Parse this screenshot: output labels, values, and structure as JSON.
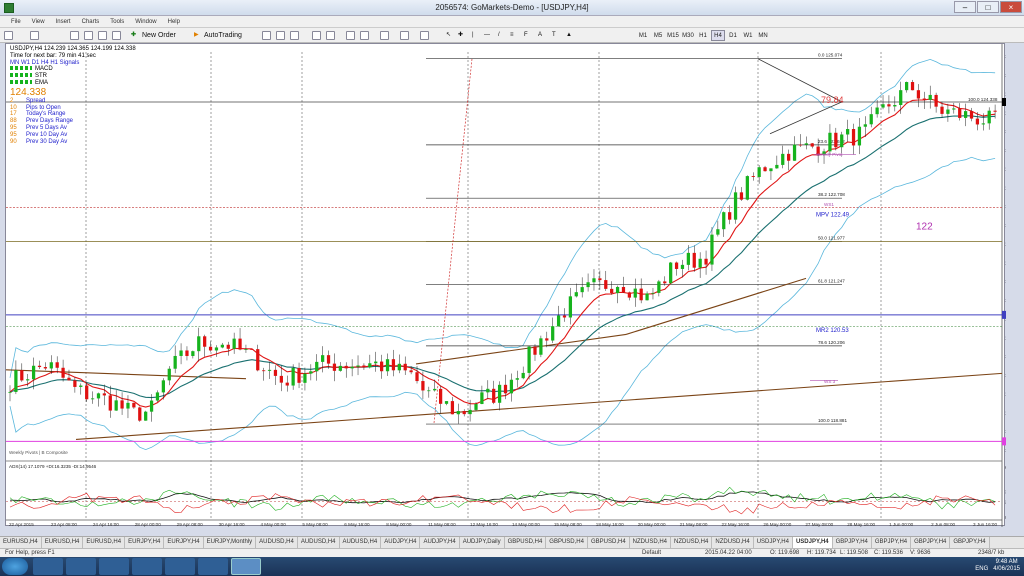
{
  "window": {
    "title": "2056574: GoMarkets-Demo - [USDJPY,H4]"
  },
  "menu": [
    "File",
    "View",
    "Insert",
    "Charts",
    "Tools",
    "Window",
    "Help"
  ],
  "toolbar": {
    "new_order": "New Order",
    "auto_trading": "AutoTrading",
    "timeframes": [
      "M1",
      "M5",
      "M15",
      "M30",
      "H1",
      "H4",
      "D1",
      "W1",
      "MN"
    ],
    "active_tf": "H4"
  },
  "info": {
    "line1": "USDJPY,H4  124.239 124.365 124.199 124.338",
    "line2": "Time for next bar: 79 min 41 sec",
    "line3": "MN W1 D1 H4 H1 Signals",
    "indicators": [
      "MACD",
      "STR",
      "EMA"
    ],
    "price": "124.338",
    "rows": [
      {
        "v": "2",
        "label": "Spread"
      },
      {
        "v": "10",
        "label": "Pips to Open"
      },
      {
        "v": "17",
        "label": "Today's Range"
      },
      {
        "v": "88",
        "label": "Prev Days Range"
      },
      {
        "v": "95",
        "label": "Prev 5 Days Av"
      },
      {
        "v": "95",
        "label": "Prev 10 Day Av"
      },
      {
        "v": "90",
        "label": "Prev 30 Day Av"
      }
    ],
    "colors": {
      "price": "#e08000",
      "value": "#e08000",
      "label": "#2222cc"
    }
  },
  "chart_data": {
    "type": "candlestick",
    "symbol": "USDJPY",
    "timeframe": "H4",
    "ylim": [
      118.34,
      125.185
    ],
    "price_ticks": [
      "125.185",
      "124.880",
      "124.090",
      "123.880",
      "123.495",
      "123.100",
      "122.805",
      "122.500",
      "122.210",
      "121.905",
      "121.615",
      "121.310",
      "121.020",
      "120.715",
      "120.425",
      "120.125",
      "119.835",
      "119.530",
      "119.235",
      "118.940",
      "118.640",
      "118.340"
    ],
    "time_labels": [
      "22 Apr 2015",
      "23 Apr 08:00",
      "24 Apr 16:00",
      "28 Apr 00:00",
      "29 Apr 08:00",
      "30 Apr 16:00",
      "4 May 00:00",
      "5 May 08:00",
      "6 May 16:00",
      "8 May 00:00",
      "11 May 08:00",
      "12 May 16:00",
      "14 May 00:00",
      "15 May 08:00",
      "18 May 16:00",
      "20 May 00:00",
      "21 May 08:00",
      "22 May 16:00",
      "26 May 00:00",
      "27 May 08:00",
      "28 May 16:00",
      "1 Jun 00:00",
      "2 Jun 08:00",
      "3 Jun 16:00"
    ],
    "current_price": {
      "value": 124.338,
      "label": "124.338"
    },
    "fib_levels": [
      {
        "label": "0.0  125.074",
        "value": 125.074
      },
      {
        "label": "23.6  123.612",
        "value": 123.612
      },
      {
        "label": "38.2  122.708",
        "value": 122.708
      },
      {
        "label": "50.0  121.977",
        "value": 121.977
      },
      {
        "label": "61.8  121.247",
        "value": 121.247
      },
      {
        "label": "78.6  120.206",
        "value": 120.206
      },
      {
        "label": "100.0  118.881",
        "value": 118.881
      }
    ],
    "fib_anchor_label": "100.0 124.338",
    "hlines": [
      {
        "label": "120.731",
        "value": 120.731,
        "color": "#4040c0"
      },
      {
        "label": "118.588",
        "value": 118.588,
        "color": "#e040e0"
      }
    ],
    "annotations": {
      "triangle_target": "79.84",
      "weekly_pivot": "Weekly Pivot",
      "ws1": "WS1",
      "mpv": "MPV  122.49",
      "mr2": "MR2  120.53",
      "ws3": "WS 3",
      "level_122": "122",
      "footer": "Weekly Pivots | B Composite"
    },
    "adx": {
      "title": "ADX(14) 17.1079 +DI:16.3235 -DI:14.9546",
      "ylim": [
        0,
        65
      ],
      "ticks": [
        "65",
        "33",
        "20.0000",
        "0"
      ]
    },
    "colors": {
      "bull": "#16b31d",
      "bear": "#e01010",
      "ema_fast": "#e01515",
      "ema_slow": "#1a7070",
      "band": "#5ab7dc",
      "trend": "#7b4416",
      "fib": "#333333"
    }
  },
  "tabs": [
    "EURUSD,H4",
    "EURUSD,H4",
    "EURUSD,H4",
    "EURJPY,H4",
    "EURJPY,H4",
    "EURJPY,Monthly",
    "AUDUSD,H4",
    "AUDUSD,H4",
    "AUDUSD,H4",
    "AUDJPY,H4",
    "AUDJPY,H4",
    "AUDJPY,Daily",
    "GBPUSD,H4",
    "GBPUSD,H4",
    "GBPUSD,H4",
    "NZDUSD,H4",
    "NZDUSD,H4",
    "NZDUSD,H4",
    "USDJPY,H4",
    "USDJPY,H4",
    "GBPJPY,H4",
    "GBPJPY,H4",
    "GBPJPY,H4",
    "GBPJPY,H4"
  ],
  "active_tab": 19,
  "status": {
    "help": "For Help, press F1",
    "profile": "Default",
    "time": "2015.04.22 04:00",
    "open": "O: 119.698",
    "high": "H: 119.734",
    "low": "L: 119.508",
    "close": "C: 119.536",
    "volume": "V: 9636",
    "traffic": "2348/7 kb"
  },
  "tray": {
    "lang": "ENG",
    "time": "9:48 AM",
    "date": "4/06/2015"
  }
}
